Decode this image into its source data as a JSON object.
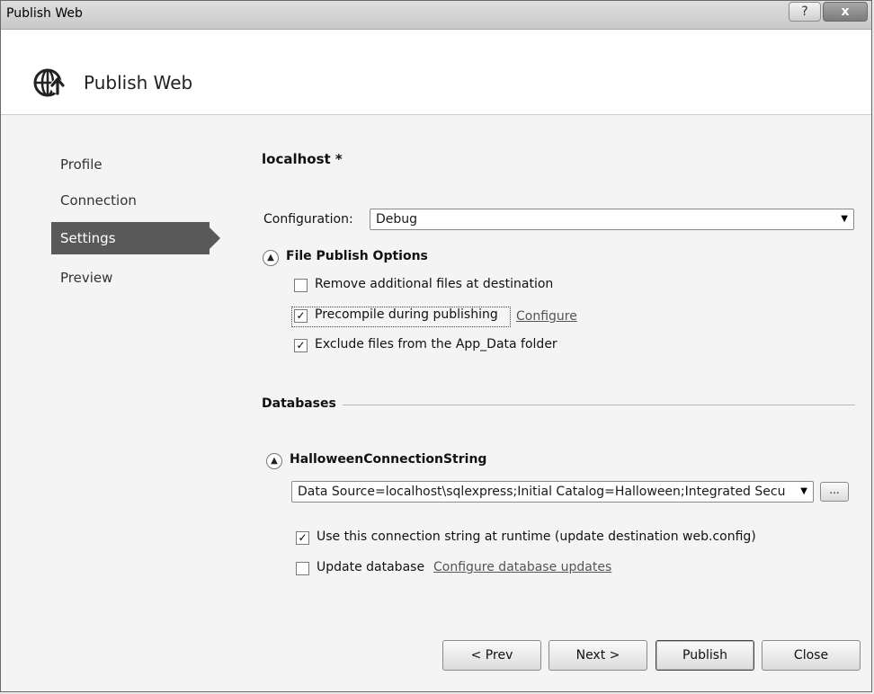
{
  "window": {
    "title": "Publish Web",
    "help_glyph": "?",
    "close_glyph": "x"
  },
  "header": {
    "title": "Publish Web",
    "logo_icon": "globe-upload-icon"
  },
  "sidebar": {
    "items": [
      {
        "label": "Profile",
        "active": false
      },
      {
        "label": "Connection",
        "active": false
      },
      {
        "label": "Settings",
        "active": true
      },
      {
        "label": "Preview",
        "active": false
      }
    ]
  },
  "main": {
    "profile_name": "localhost *",
    "configuration": {
      "label": "Configuration:",
      "value": "Debug"
    },
    "file_publish": {
      "title": "File Publish Options",
      "options": [
        {
          "label": "Remove additional files at destination",
          "checked": false
        },
        {
          "label": "Precompile during publishing",
          "checked": true,
          "link": "Configure"
        },
        {
          "label": "Exclude files from the App_Data folder",
          "checked": true
        }
      ]
    },
    "databases": {
      "title": "Databases",
      "connection": {
        "name": "HalloweenConnectionString",
        "value": "Data Source=localhost\\sqlexpress;Initial Catalog=Halloween;Integrated Secu",
        "browse_label": "...",
        "use_at_runtime": {
          "label": "Use this connection string at runtime (update destination web.config)",
          "checked": true
        },
        "update_database": {
          "label": "Update database",
          "checked": false,
          "link": "Configure database updates"
        }
      }
    }
  },
  "buttons": {
    "prev": "< Prev",
    "next": "Next >",
    "publish": "Publish",
    "close": "Close"
  },
  "colors": {
    "active_nav": "#595959",
    "header_bg": "#ffffff",
    "body_bg": "#f4f4f4"
  }
}
